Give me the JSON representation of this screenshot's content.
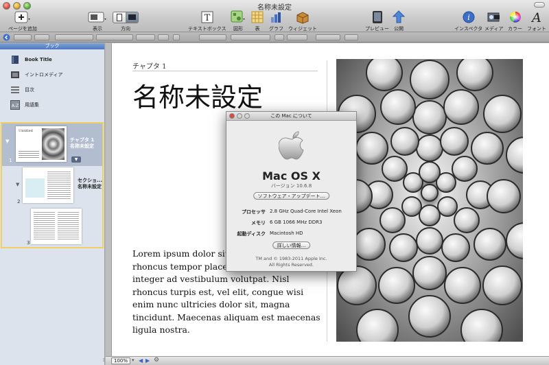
{
  "window": {
    "title": "名称未設定"
  },
  "toolbar": {
    "add_page": "ページを追加",
    "view": "表示",
    "orientation": "方向",
    "textbox": "テキストボックス",
    "shapes": "図形",
    "table": "表",
    "chart": "グラフ",
    "widget": "ウィジェット",
    "preview": "プレビュー",
    "publish": "公開",
    "inspector": "インスペクタ",
    "media": "メディア",
    "colors": "カラー",
    "fonts": "フォント"
  },
  "sidebar": {
    "header": "ブック",
    "items": [
      {
        "label": "Book Title",
        "icon": "book-icon"
      },
      {
        "label": "イントロメディア",
        "icon": "film-icon"
      },
      {
        "label": "目次",
        "icon": "list-icon"
      },
      {
        "label": "用語集",
        "icon": "glossary-icon"
      }
    ],
    "pages": [
      {
        "num": "1",
        "line1": "チャプタ 1",
        "line2": "名称未設定"
      },
      {
        "num": "2",
        "line1": "セクショ...",
        "line2": "名称未設定"
      },
      {
        "num": "3"
      }
    ],
    "thumb_title": "Untitled"
  },
  "document": {
    "chapter_label": "チャプタ 1",
    "title": "名称未設定",
    "body": "Lorem ipsum dolor sit amet, nulla pretium, rhoncus tempor placerat fermentum, enim integer ad vestibulum volutpat. Nisl rhoncus turpis est, vel elit, congue wisi enim nunc ultricies dolor sit, magna tincidunt. Maecenas aliquam est maecenas ligula nostra."
  },
  "about": {
    "title": "この Mac について",
    "os_name": "Mac OS X",
    "version": "バージョン 10.6.8",
    "update_button": "ソフトウェア・アップデート...",
    "specs": [
      {
        "key": "プロセッサ",
        "value": "2.8 GHz Quad-Core Intel Xeon"
      },
      {
        "key": "メモリ",
        "value": "6 GB 1066 MHz DDR3"
      },
      {
        "key": "起動ディスク",
        "value": "Macintosh HD"
      }
    ],
    "more_info_button": "詳しい情報...",
    "footer1": "TM and © 1983-2011 Apple Inc.",
    "footer2": "All Rights Reserved."
  },
  "bottom": {
    "zoom": "100%"
  }
}
